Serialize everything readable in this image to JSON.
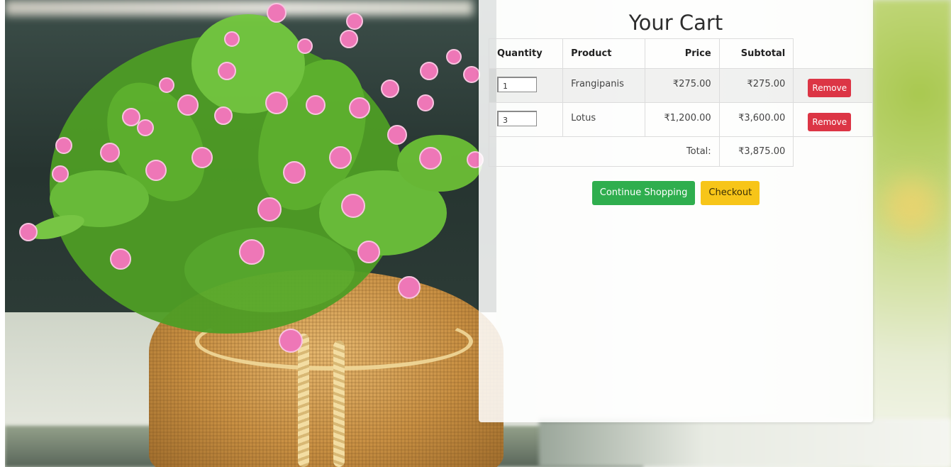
{
  "cart": {
    "title": "Your Cart",
    "columns": {
      "quantity": "Quantity",
      "product": "Product",
      "price": "Price",
      "subtotal": "Subtotal"
    },
    "items": [
      {
        "quantity": "1",
        "product": "Frangipanis",
        "price": "₹275.00",
        "subtotal": "₹275.00",
        "remove_label": "Remove"
      },
      {
        "quantity": "3",
        "product": "Lotus",
        "price": "₹1,200.00",
        "subtotal": "₹3,600.00",
        "remove_label": "Remove"
      }
    ],
    "total_label": "Total:",
    "total_value": "₹3,875.00",
    "buttons": {
      "continue_shopping": "Continue Shopping",
      "checkout": "Checkout"
    }
  },
  "colors": {
    "remove": "#dc3545",
    "continue": "#2fae4e",
    "checkout": "#f7c519"
  }
}
